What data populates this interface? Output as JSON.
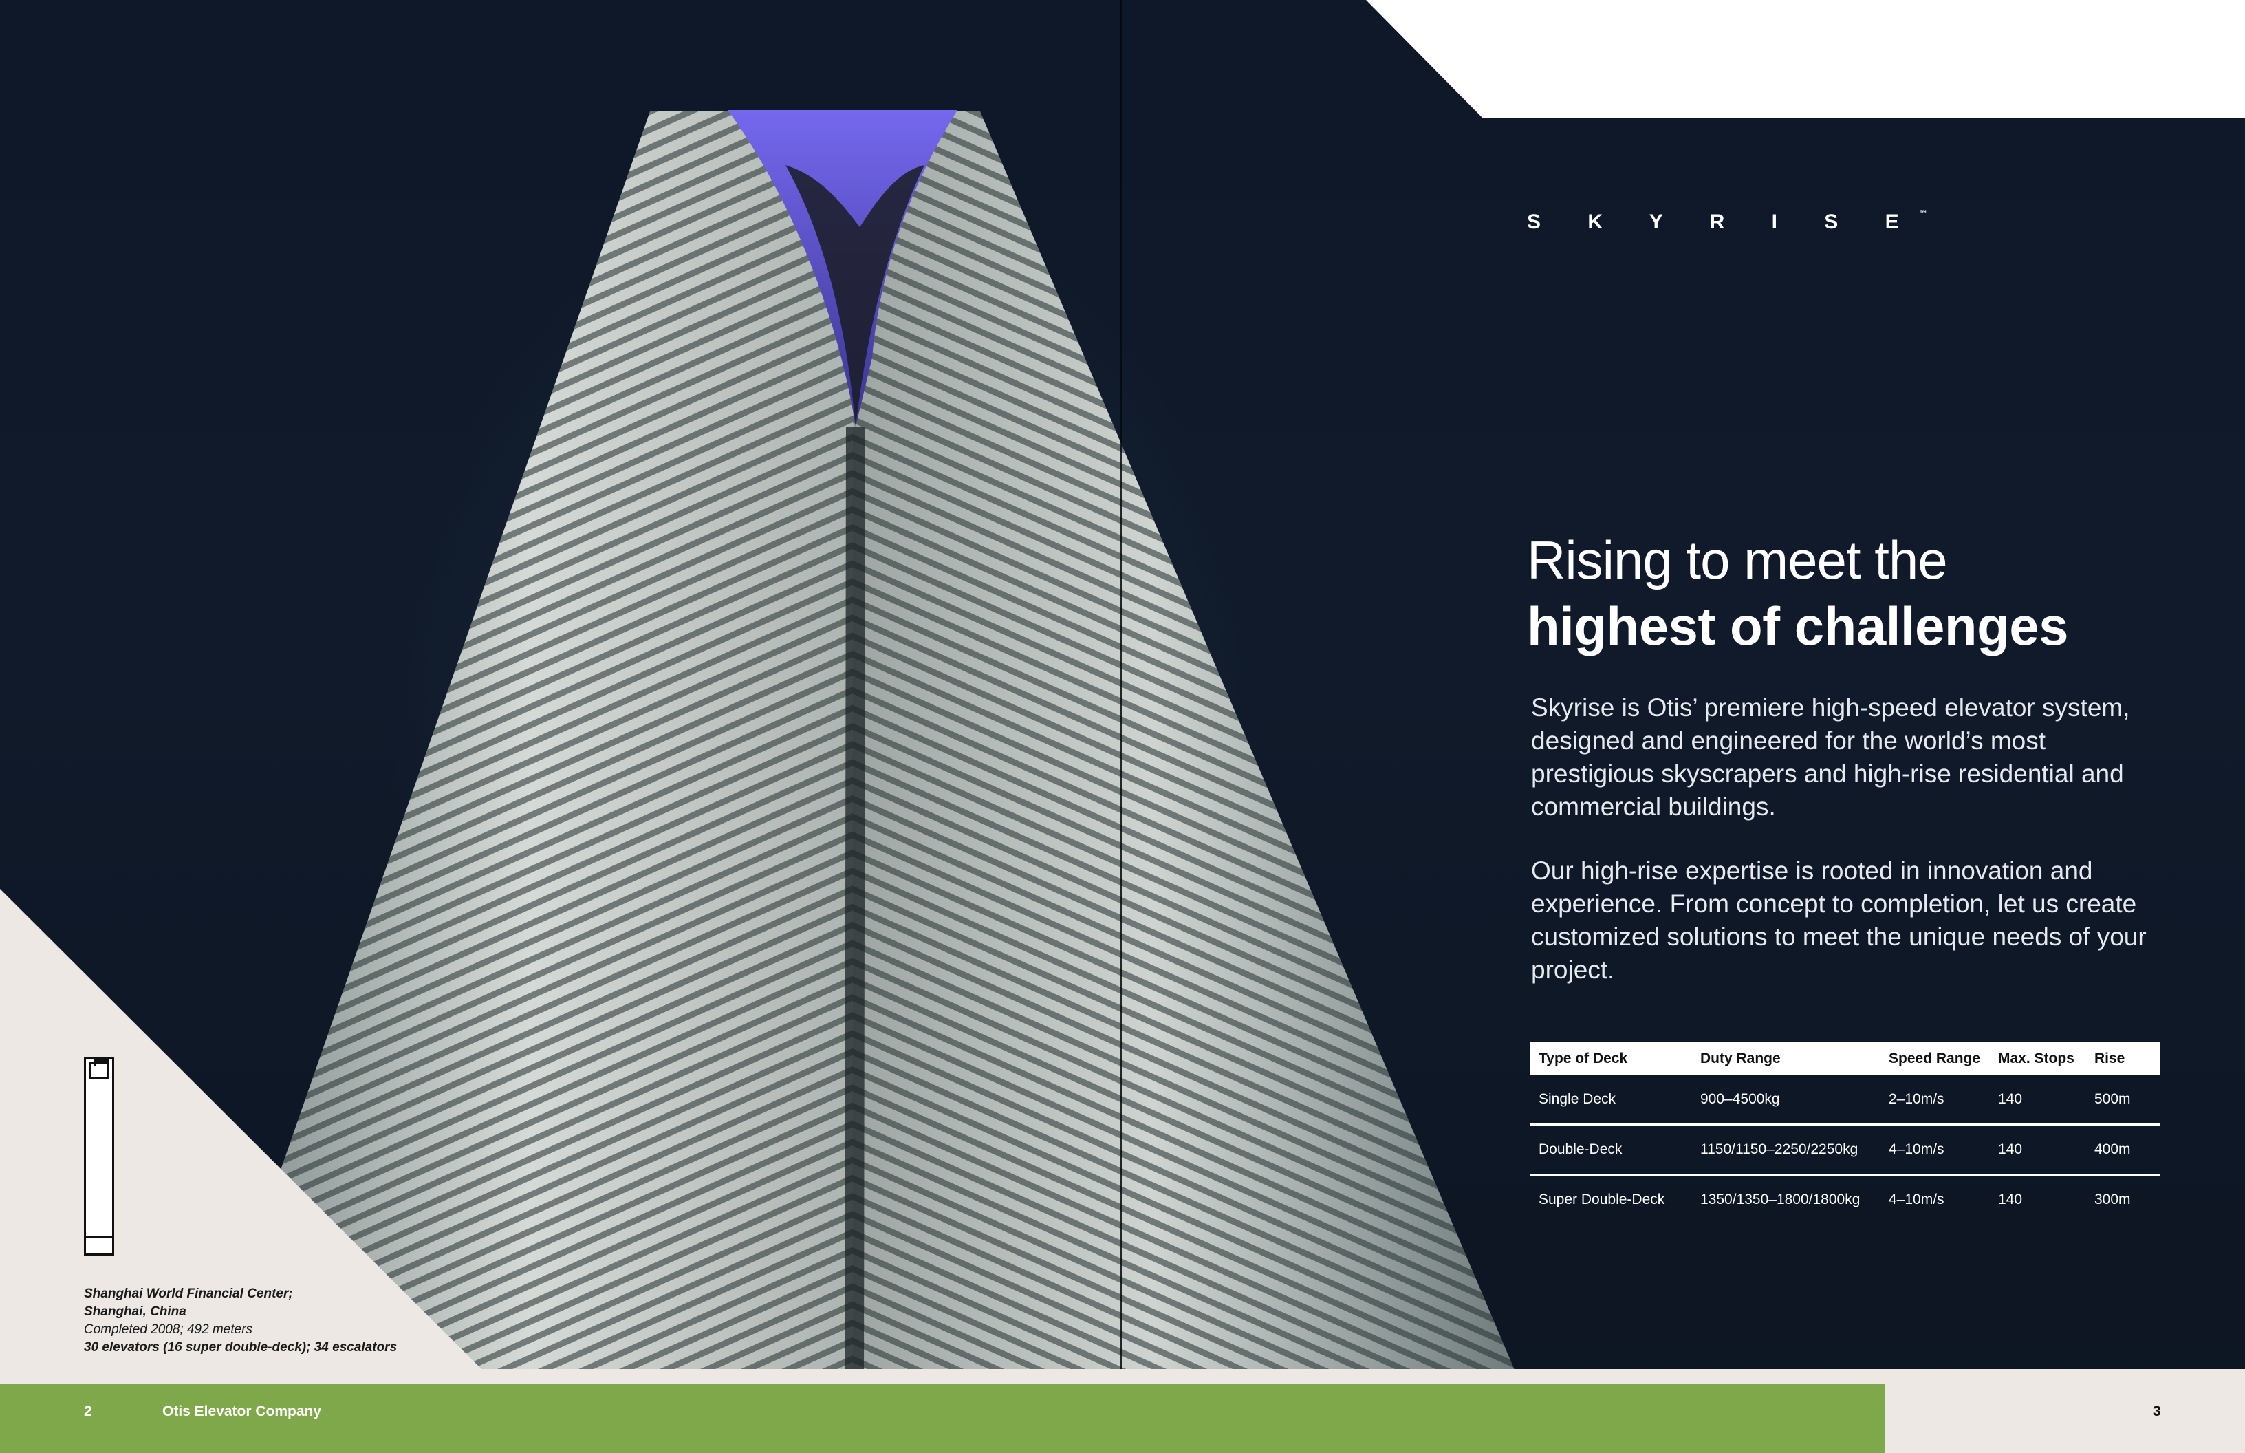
{
  "brand": {
    "name": "S K Y R I S E",
    "mark": "™"
  },
  "heading": {
    "line1": "Rising to meet the",
    "line2": "highest of challenges"
  },
  "paragraphs": [
    "Skyrise is Otis’ premiere high-speed elevator system, designed and engineered for the world’s most prestigious skyscrapers and high-rise residential and commercial buildings.",
    "Our high-rise expertise is rooted in innovation and experience. From concept to completion, let us create customized solutions to meet the unique needs of your project."
  ],
  "spec_table": {
    "headers": [
      "Type of Deck",
      "Duty Range",
      "Speed Range",
      "Max. Stops",
      "Rise"
    ],
    "rows": [
      [
        "Single Deck",
        "900–4500kg",
        "2–10m/s",
        "140",
        "500m"
      ],
      [
        "Double-Deck",
        "1150/1150–2250/2250kg",
        "4–10m/s",
        "140",
        "400m"
      ],
      [
        "Super Double-Deck",
        "1350/1350–1800/1800kg",
        "4–10m/s",
        "140",
        "300m"
      ]
    ]
  },
  "caption": {
    "line1": "Shanghai World Financial Center;",
    "line2": "Shanghai, China",
    "line3": "Completed 2008; 492 meters",
    "line4": "30 elevators (16 super double-deck); 34 escalators"
  },
  "footer": {
    "page_left": "2",
    "company": "Otis Elevator Company",
    "page_right": "3"
  },
  "colors": {
    "footer_green": "#7ea84a",
    "caption_panel": "#ede8e3",
    "night_sky": "#0e1829",
    "crown_light": "#6a5fe0"
  }
}
